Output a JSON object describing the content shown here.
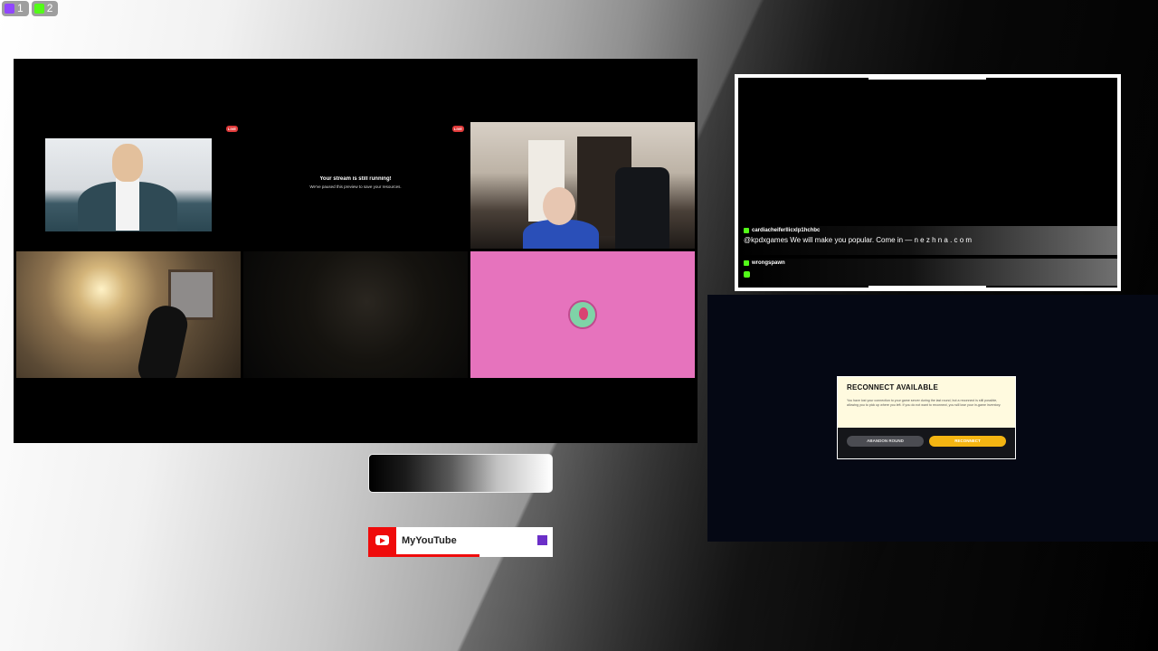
{
  "platform_badges": [
    {
      "icon": "twitch-icon",
      "count": "1",
      "color": "#9146ff"
    },
    {
      "icon": "kick-icon",
      "count": "2",
      "color": "#53fc18"
    }
  ],
  "stream_grid": {
    "live_label": "LIVE",
    "paused_title": "Your stream is still running!",
    "paused_subtitle": "We've paused this preview to save your resources."
  },
  "chat": {
    "messages": [
      {
        "user": "cardiacheiferllicxlp1hchbc",
        "text": "@kpdxgames We will make you popular. Come in — n e z h n a . c o m"
      },
      {
        "user": "wrongspawn",
        "text": ""
      }
    ]
  },
  "game": {
    "dialog_title": "RECONNECT AVAILABLE",
    "dialog_body": "You have lost your connection to your game server during the last round, but a reconnect is still possible, allowing you to pick up where you left. If you do not want to reconnect, you will lose your in-game inventory.",
    "abandon_label": "ABANDON ROUND",
    "reconnect_label": "RECONNECT",
    "accent_color": "#f4b512"
  },
  "youtube_widget": {
    "name": "MyYouTube",
    "icon": "youtube-icon",
    "color": "#ef0b0b"
  }
}
